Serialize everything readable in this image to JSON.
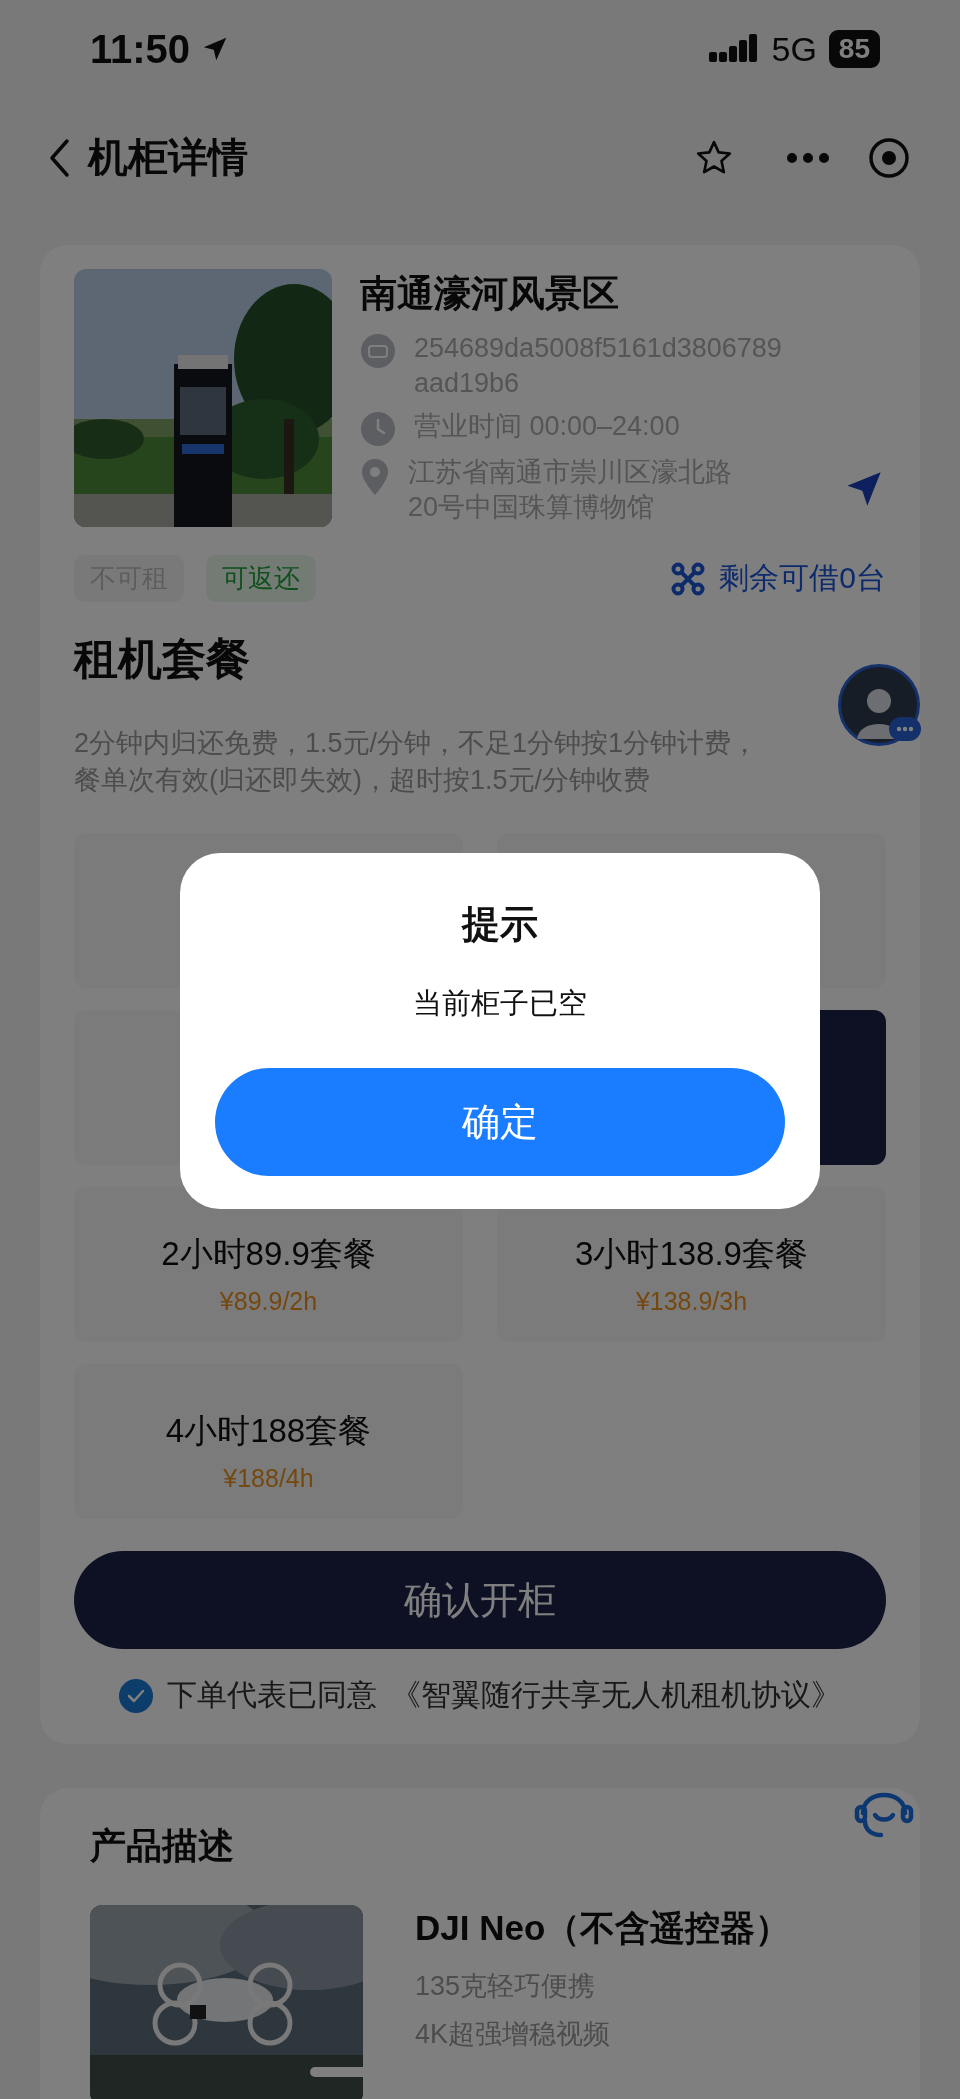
{
  "status_bar": {
    "time": "11:50",
    "network": "5G",
    "battery": "85"
  },
  "nav": {
    "title": "机柜详情"
  },
  "cabinet": {
    "name": "南通濠河风景区",
    "id_lines": [
      "254689da5008f5161d3806789",
      "aad19b6"
    ],
    "hours": "营业时间 00:00–24:00",
    "address_lines": [
      "江苏省南通市崇川区濠北路",
      "20号中国珠算博物馆"
    ]
  },
  "tags": [
    {
      "kind": "off",
      "label": "不可租"
    },
    {
      "kind": "on",
      "label": "可返还"
    }
  ],
  "stock": "剩余可借0台",
  "section_title": "租机套餐",
  "description_lines": [
    "2分钟内归还免费，1.5元/分钟，不足1分钟按1分钟计费，",
    "餐单次有效(归还即失效)，超时按1.5元/分钟收费"
  ],
  "plans": [
    {
      "selected": false
    },
    {
      "selected": false
    },
    {
      "selected": false
    },
    {
      "selected": true
    },
    {
      "name": "2小时89.9套餐",
      "price": "¥89.9/2h",
      "selected": false
    },
    {
      "name": "3小时138.9套餐",
      "price": "¥138.9/3h",
      "selected": false
    },
    {
      "name": "4小时188套餐",
      "price": "¥188/4h",
      "selected": false
    }
  ],
  "confirm_button": "确认开柜",
  "agreement": {
    "checked": true,
    "text": "下单代表已同意",
    "link": "《智翼随行共享无人机租机协议》"
  },
  "product": {
    "section_title": "产品描述",
    "name": "DJI Neo（不含遥控器）",
    "features": [
      "135克轻巧便携",
      "4K超强增稳视频"
    ]
  },
  "dialog": {
    "title": "提示",
    "message": "当前柜子已空",
    "button": "确定"
  }
}
